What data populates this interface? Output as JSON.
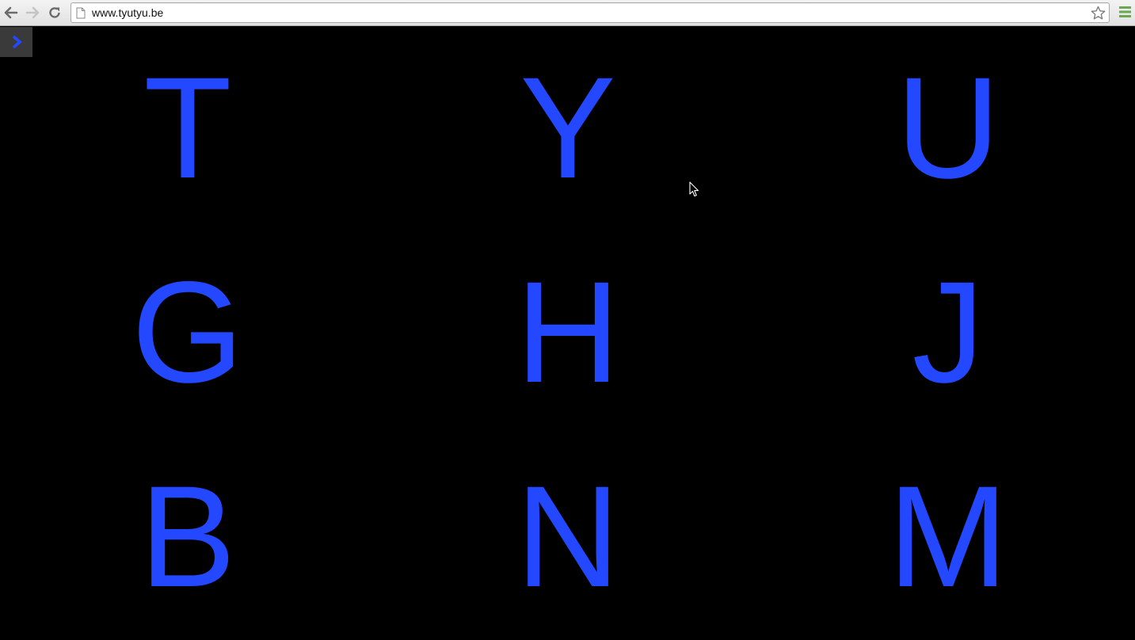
{
  "browser": {
    "url": "www.tyutyu.be"
  },
  "icons": {
    "back": "back-arrow-icon",
    "forward": "forward-arrow-icon",
    "reload": "reload-icon",
    "page": "page-icon",
    "bookmark": "star-icon",
    "menu": "hamburger-menu-icon",
    "sidebar_toggle": "chevron-right-icon"
  },
  "colors": {
    "letters": "#2348ff",
    "background": "#000000",
    "toggle_bg": "#3a3a3a",
    "menu_icon": "#6aa84f"
  },
  "grid": {
    "letters": [
      "T",
      "Y",
      "U",
      "G",
      "H",
      "J",
      "B",
      "N",
      "M"
    ]
  }
}
